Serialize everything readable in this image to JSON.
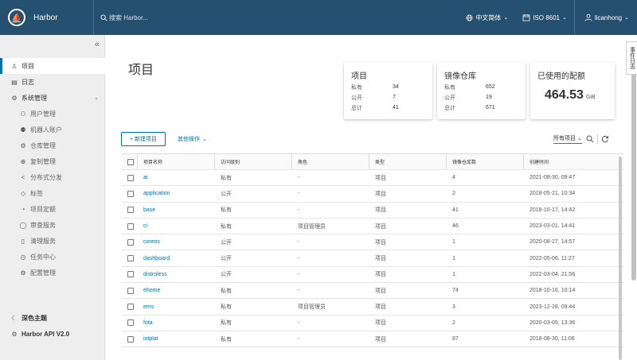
{
  "header": {
    "logo_char": "⛵",
    "brand": "Harbor",
    "search_placeholder": "搜索 Harbor...",
    "language": "中文简体",
    "date_format": "ISO 8601",
    "user": "licanhong",
    "bg_color": "#25506f"
  },
  "sidebar": {
    "collapse": "«",
    "items": [
      {
        "label": "项目",
        "icon": "projects-icon",
        "glyph": "♙"
      },
      {
        "label": "日志",
        "icon": "logs-icon",
        "glyph": "▤"
      },
      {
        "label": "系统管理",
        "icon": "system-admin-icon",
        "glyph": "⚙"
      }
    ],
    "sub_items": [
      {
        "label": "用户管理",
        "icon": "users-icon",
        "glyph": "⚇"
      },
      {
        "label": "机器人账户",
        "icon": "robot-icon",
        "glyph": "⚉"
      },
      {
        "label": "仓库管理",
        "icon": "registries-icon",
        "glyph": "⚙"
      },
      {
        "label": "复制管理",
        "icon": "replication-icon",
        "glyph": "⊕"
      },
      {
        "label": "分布式分发",
        "icon": "distribution-icon",
        "glyph": "<"
      },
      {
        "label": "标签",
        "icon": "label-icon",
        "glyph": "◇"
      },
      {
        "label": "项目定额",
        "icon": "quota-icon",
        "glyph": "◔"
      },
      {
        "label": "审查服务",
        "icon": "interrogation-icon",
        "glyph": "◯"
      },
      {
        "label": "清理服务",
        "icon": "gc-icon",
        "glyph": "▯"
      },
      {
        "label": "任务中心",
        "icon": "jobs-icon",
        "glyph": "◷"
      },
      {
        "label": "配置管理",
        "icon": "config-icon",
        "glyph": "⚙"
      }
    ],
    "bottom": [
      {
        "label": "深色主题",
        "icon": "moon-icon",
        "glyph": "☾"
      },
      {
        "label": "Harbor API V2.0",
        "icon": "api-icon",
        "glyph": "⚙"
      }
    ]
  },
  "main": {
    "title": "项目",
    "cards": {
      "projects": {
        "title": "项目",
        "rows": [
          {
            "label": "私有",
            "value": "34"
          },
          {
            "label": "公开",
            "value": "7"
          },
          {
            "label": "总计",
            "value": "41"
          }
        ]
      },
      "repos": {
        "title": "镜像仓库",
        "rows": [
          {
            "label": "私有",
            "value": "652"
          },
          {
            "label": "公开",
            "value": "19"
          },
          {
            "label": "总计",
            "value": "671"
          }
        ]
      },
      "quota": {
        "title": "已使用的配额",
        "value": "464.53",
        "unit": "GiB"
      }
    },
    "new_project": "+ 新建项目",
    "other_ops": "其他操作",
    "filter_select": "所有项目",
    "event_tab": "事件日志"
  },
  "table": {
    "headers": [
      "项目名称",
      "访问级别",
      "角色",
      "类型",
      "镜像仓库数",
      "创建时间"
    ],
    "rows": [
      {
        "name": "ai",
        "access": "私有",
        "role": "-",
        "type": "项目",
        "count": "4",
        "time": "2021-08-30, 09:47"
      },
      {
        "name": "application",
        "access": "公开",
        "role": "-",
        "type": "项目",
        "count": "2",
        "time": "2018-05-21, 10:34"
      },
      {
        "name": "base",
        "access": "私有",
        "role": "-",
        "type": "项目",
        "count": "41",
        "time": "2018-10-17, 14:42"
      },
      {
        "name": "ci",
        "access": "私有",
        "role": "项目管理员",
        "type": "项目",
        "count": "46",
        "time": "2023-03-01, 14:41"
      },
      {
        "name": "coreos",
        "access": "公开",
        "role": "-",
        "type": "项目",
        "count": "1",
        "time": "2020-08-27, 14:57"
      },
      {
        "name": "dashboard",
        "access": "公开",
        "role": "-",
        "type": "项目",
        "count": "1",
        "time": "2022-05-06, 11:27"
      },
      {
        "name": "distroless",
        "access": "公开",
        "role": "-",
        "type": "项目",
        "count": "1",
        "time": "2022-03-04, 21:56"
      },
      {
        "name": "ehome",
        "access": "私有",
        "role": "-",
        "type": "项目",
        "count": "74",
        "time": "2018-10-16, 10:14"
      },
      {
        "name": "ems",
        "access": "私有",
        "role": "项目管理员",
        "type": "项目",
        "count": "3",
        "time": "2023-12-28, 09:44"
      },
      {
        "name": "fota",
        "access": "私有",
        "role": "-",
        "type": "项目",
        "count": "2",
        "time": "2020-03-05, 13:36"
      },
      {
        "name": "iotplat",
        "access": "私有",
        "role": "-",
        "type": "项目",
        "count": "87",
        "time": "2018-08-30, 11:06"
      }
    ]
  }
}
